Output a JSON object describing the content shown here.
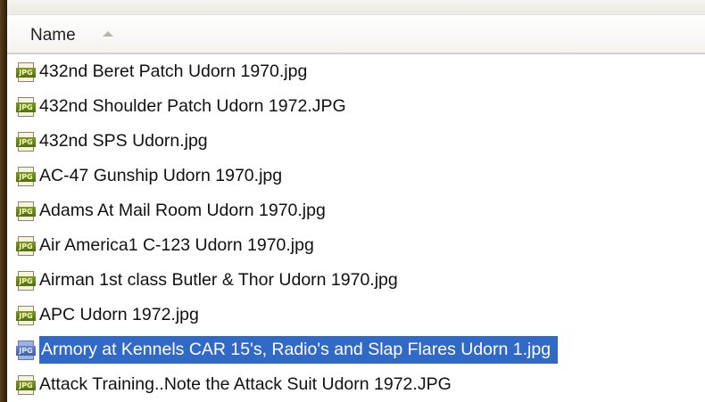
{
  "header": {
    "column_name": "Name",
    "sort": "ascending"
  },
  "files": [
    {
      "name": "432nd Beret Patch  Udorn 1970.jpg",
      "icon": "jpg-file-icon",
      "badge": "JPG",
      "selected": false
    },
    {
      "name": "432nd Shoulder Patch  Udorn 1972.JPG",
      "icon": "jpg-file-icon",
      "badge": "JPG",
      "selected": false
    },
    {
      "name": "432nd SPS  Udorn.jpg",
      "icon": "jpg-file-icon",
      "badge": "JPG",
      "selected": false
    },
    {
      "name": "AC-47 Gunship  Udorn 1970.jpg",
      "icon": "jpg-file-icon",
      "badge": "JPG",
      "selected": false
    },
    {
      "name": "Adams At Mail Room  Udorn 1970.jpg",
      "icon": "jpg-file-icon",
      "badge": "JPG",
      "selected": false
    },
    {
      "name": "Air America1 C-123  Udorn 1970.jpg",
      "icon": "jpg-file-icon",
      "badge": "JPG",
      "selected": false
    },
    {
      "name": "Airman 1st class Butler & Thor  Udorn 1970.jpg",
      "icon": "jpg-file-icon",
      "badge": "JPG",
      "selected": false
    },
    {
      "name": "APC  Udorn 1972.jpg",
      "icon": "jpg-file-icon",
      "badge": "JPG",
      "selected": false
    },
    {
      "name": "Armory at Kennels CAR 15's, Radio's and Slap Flares  Udorn 1.jpg",
      "icon": "jpg-file-icon",
      "badge": "JPG",
      "selected": true
    },
    {
      "name": "Attack Training..Note the Attack Suit  Udorn 1972.JPG",
      "icon": "jpg-file-icon",
      "badge": "JPG",
      "selected": false
    }
  ],
  "colors": {
    "selection": "#3169c6",
    "selection_text": "#ffffff",
    "icon_badge": "#5d7d1a"
  }
}
